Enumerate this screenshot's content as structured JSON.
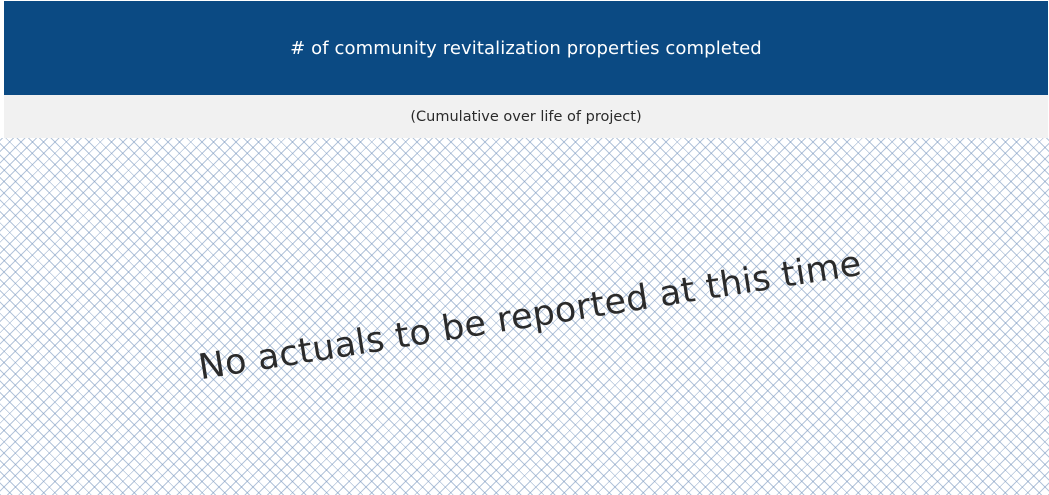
{
  "header": {
    "title": "# of community revitalization properties completed",
    "background_color": "#0b4a83"
  },
  "subheader": {
    "text": "(Cumulative over life of project)"
  },
  "placeholder": {
    "message": "No actuals to be reported at this time",
    "pattern": "diagonal-crosshatch"
  }
}
